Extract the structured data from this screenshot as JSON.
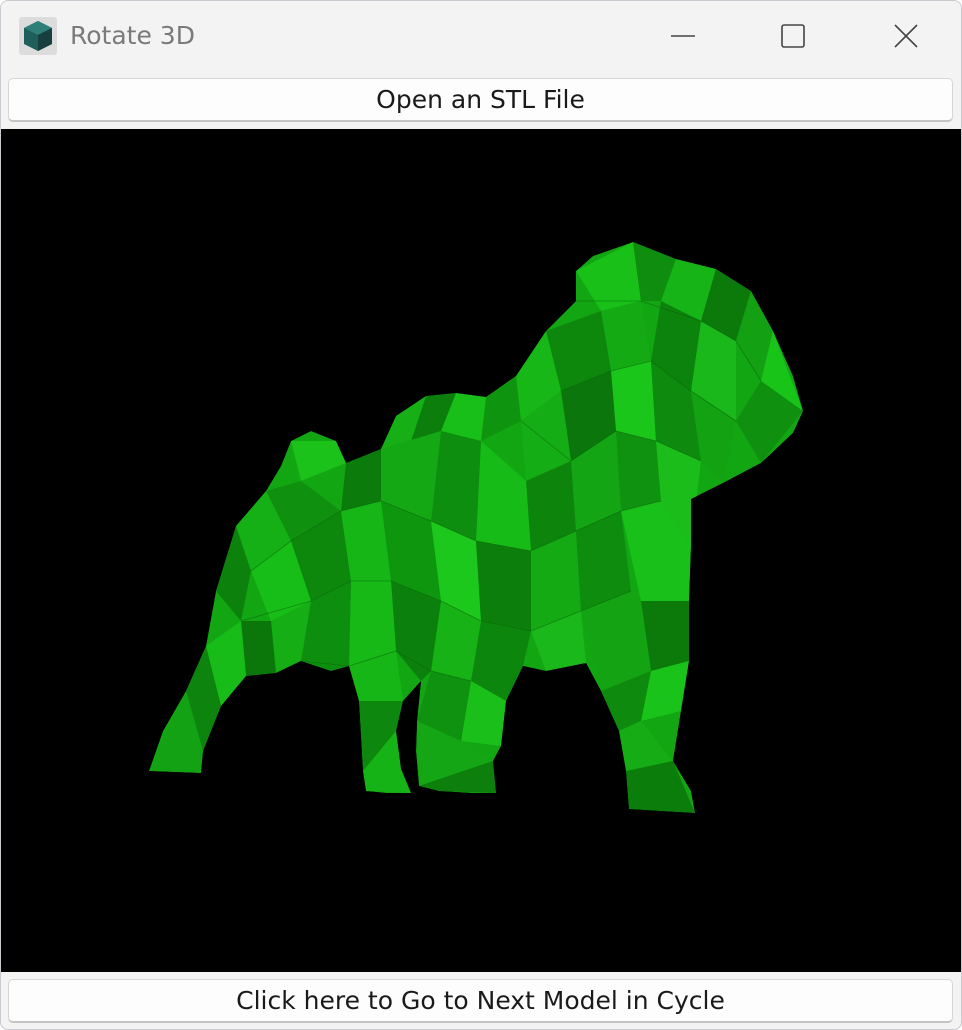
{
  "window": {
    "title": "Rotate 3D",
    "app_icon": "hexagon-prism-icon",
    "controls": {
      "minimize_icon": "minimize-icon",
      "maximize_icon": "maximize-icon",
      "close_icon": "close-icon"
    }
  },
  "toolbar": {
    "open_button_label": "Open an STL File"
  },
  "viewport": {
    "model_color": "#11b011",
    "background_color": "#000000"
  },
  "footer": {
    "next_button_label": "Click here to Go to Next Model in Cycle"
  }
}
